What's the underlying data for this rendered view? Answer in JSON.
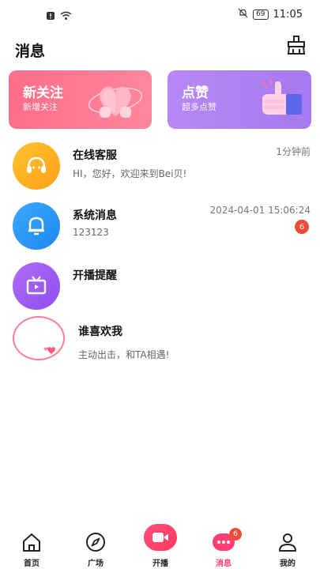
{
  "status_bar": {
    "time": "11:05",
    "battery": "69"
  },
  "header": {
    "title": "消息",
    "clean_icon": "broom-icon"
  },
  "cards": {
    "follow": {
      "title": "新关注",
      "subtitle": "新增关注"
    },
    "like": {
      "title": "点赞",
      "subtitle": "超多点赞"
    }
  },
  "messages": [
    {
      "title": "在线客服",
      "subtitle": "HI，您好，欢迎来到Bei贝!",
      "time": "1分钟前",
      "icon": "headset-icon"
    },
    {
      "title": "系统消息",
      "subtitle": "123123",
      "time": "2024-04-01 15:06:24",
      "icon": "bell-icon",
      "badge": "6"
    },
    {
      "title": "开播提醒",
      "subtitle": "",
      "time": "",
      "icon": "tv-icon"
    }
  ],
  "who_likes": {
    "title": "谁喜欢我",
    "subtitle": "主动出击，和TA相遇!"
  },
  "tabbar": {
    "home": "首页",
    "square": "广场",
    "live": "开播",
    "messages": "消息",
    "messages_badge": "6",
    "me": "我的"
  },
  "colors": {
    "accent": "#ff3f73",
    "follow_card": "#ff7490",
    "like_card": "#b084f3"
  }
}
